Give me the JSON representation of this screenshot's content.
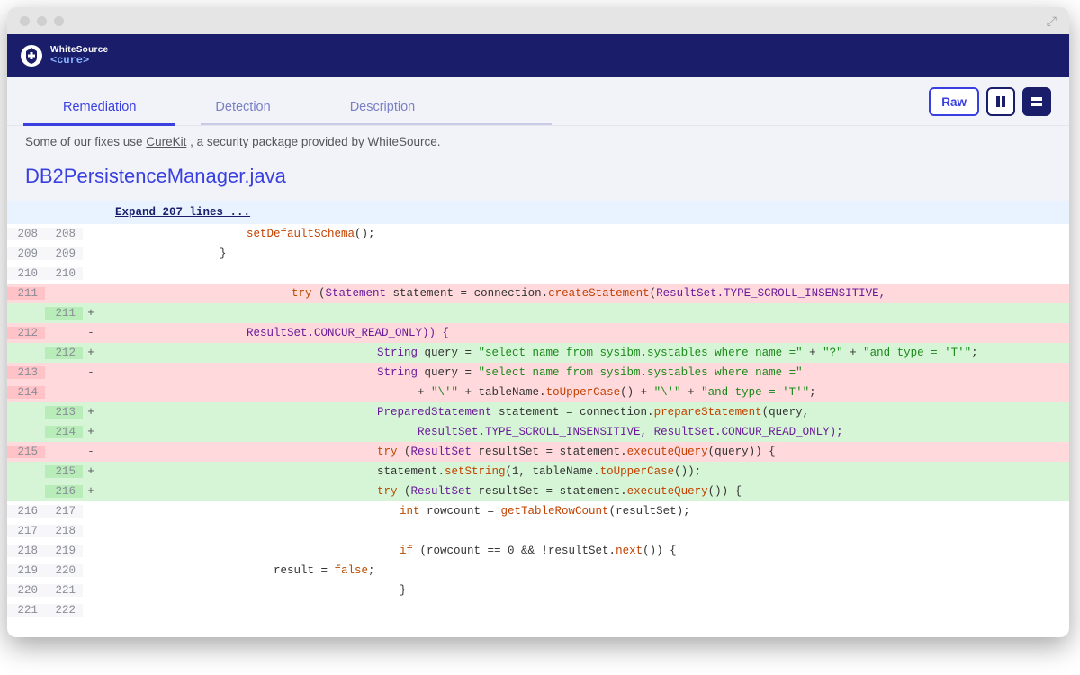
{
  "brand": {
    "name": "WhiteSource",
    "product": "<cure>"
  },
  "tabs": {
    "remediation": "Remediation",
    "detection": "Detection",
    "description": "Description"
  },
  "toolbar": {
    "raw": "Raw"
  },
  "note": {
    "pre": "Some of our fixes use ",
    "link": "CureKit",
    "post": " , a security package provided by WhiteSource."
  },
  "file": {
    "name": "DB2PersistenceManager.java"
  },
  "expand": {
    "label": "Expand 207 lines ..."
  },
  "lines": [
    {
      "type": "ctx",
      "old": "208",
      "new": "208",
      "sign": " ",
      "tokens": [
        {
          "ind": "w160"
        },
        {
          "t": "setDefaultSchema",
          "c": "mth"
        },
        {
          "t": "();",
          "c": "pun"
        }
      ]
    },
    {
      "type": "ctx",
      "old": "209",
      "new": "209",
      "sign": " ",
      "tokens": [
        {
          "ind": "w130"
        },
        {
          "t": "}",
          "c": "pun"
        }
      ]
    },
    {
      "type": "ctx",
      "old": "210",
      "new": "210",
      "sign": " ",
      "tokens": []
    },
    {
      "type": "del",
      "old": "211",
      "new": "",
      "sign": "-",
      "tokens": [
        {
          "ind": "w210"
        },
        {
          "t": "try",
          "c": "kw"
        },
        {
          "t": " ("
        },
        {
          "t": "Statement",
          "c": "typ"
        },
        {
          "t": " statement = connection."
        },
        {
          "t": "createStatement",
          "c": "mth"
        },
        {
          "t": "("
        },
        {
          "t": "ResultSet",
          "c": "typ"
        },
        {
          "t": ".TYPE_SCROLL_INSENSITIVE,",
          "c": "cnst"
        }
      ]
    },
    {
      "type": "add",
      "old": "",
      "new": "211",
      "sign": "+",
      "tokens": []
    },
    {
      "type": "del",
      "old": "212",
      "new": "",
      "sign": "-",
      "tokens": [
        {
          "ind": "w160"
        },
        {
          "t": "ResultSet",
          "c": "typ"
        },
        {
          "t": ".CONCUR_READ_ONLY)) {",
          "c": "cnst"
        }
      ]
    },
    {
      "type": "add",
      "old": "",
      "new": "212",
      "sign": "+",
      "tokens": [
        {
          "ind": "w305"
        },
        {
          "t": "String",
          "c": "typ"
        },
        {
          "t": " query = "
        },
        {
          "t": "\"select name from sysibm.systables where name =\"",
          "c": "str"
        },
        {
          "t": " + "
        },
        {
          "t": "\"?\"",
          "c": "str"
        },
        {
          "t": " + "
        },
        {
          "t": "\"and type = 'T'\"",
          "c": "str"
        },
        {
          "t": ";"
        }
      ]
    },
    {
      "type": "del",
      "old": "213",
      "new": "",
      "sign": "-",
      "tokens": [
        {
          "ind": "w305"
        },
        {
          "t": "String",
          "c": "typ"
        },
        {
          "t": " query = "
        },
        {
          "t": "\"select name from sysibm.systables where name =\"",
          "c": "str"
        }
      ]
    },
    {
      "type": "del",
      "old": "214",
      "new": "",
      "sign": "-",
      "tokens": [
        {
          "ind": "w350"
        },
        {
          "t": "+ "
        },
        {
          "t": "\"\\'\"",
          "c": "str"
        },
        {
          "t": " + tableName."
        },
        {
          "t": "toUpperCase",
          "c": "mth"
        },
        {
          "t": "() + "
        },
        {
          "t": "\"\\'\"",
          "c": "str"
        },
        {
          "t": " + "
        },
        {
          "t": "\"and type = 'T'\"",
          "c": "str"
        },
        {
          "t": ";"
        }
      ]
    },
    {
      "type": "add",
      "old": "",
      "new": "213",
      "sign": "+",
      "tokens": [
        {
          "ind": "w305"
        },
        {
          "t": "PreparedStatement",
          "c": "typ"
        },
        {
          "t": " statement = connection."
        },
        {
          "t": "prepareStatement",
          "c": "mth"
        },
        {
          "t": "(query,"
        }
      ]
    },
    {
      "type": "add",
      "old": "",
      "new": "214",
      "sign": "+",
      "tokens": [
        {
          "ind": "w350"
        },
        {
          "t": "ResultSet",
          "c": "typ"
        },
        {
          "t": ".TYPE_SCROLL_INSENSITIVE, ",
          "c": "cnst"
        },
        {
          "t": "ResultSet",
          "c": "typ"
        },
        {
          "t": ".CONCUR_READ_ONLY);",
          "c": "cnst"
        }
      ]
    },
    {
      "type": "del",
      "old": "215",
      "new": "",
      "sign": "-",
      "tokens": [
        {
          "ind": "w305"
        },
        {
          "t": "try",
          "c": "kw"
        },
        {
          "t": " ("
        },
        {
          "t": "ResultSet",
          "c": "typ"
        },
        {
          "t": " resultSet = statement."
        },
        {
          "t": "executeQuery",
          "c": "mth"
        },
        {
          "t": "(query)) {"
        }
      ]
    },
    {
      "type": "add",
      "old": "",
      "new": "215",
      "sign": "+",
      "tokens": [
        {
          "ind": "w305"
        },
        {
          "t": "statement."
        },
        {
          "t": "setString",
          "c": "mth"
        },
        {
          "t": "(1, tableName."
        },
        {
          "t": "toUpperCase",
          "c": "mth"
        },
        {
          "t": "());"
        }
      ]
    },
    {
      "type": "add",
      "old": "",
      "new": "216",
      "sign": "+",
      "tokens": [
        {
          "ind": "w305"
        },
        {
          "t": "try",
          "c": "kw"
        },
        {
          "t": " ("
        },
        {
          "t": "ResultSet",
          "c": "typ"
        },
        {
          "t": " resultSet = statement."
        },
        {
          "t": "executeQuery",
          "c": "mth"
        },
        {
          "t": "()) {"
        }
      ]
    },
    {
      "type": "ctx",
      "old": "216",
      "new": "217",
      "sign": " ",
      "tokens": [
        {
          "ind": "w330"
        },
        {
          "t": "int",
          "c": "kw"
        },
        {
          "t": " rowcount = "
        },
        {
          "t": "getTableRowCount",
          "c": "mth"
        },
        {
          "t": "(resultSet);"
        }
      ]
    },
    {
      "type": "ctx",
      "old": "217",
      "new": "218",
      "sign": " ",
      "tokens": []
    },
    {
      "type": "ctx",
      "old": "218",
      "new": "219",
      "sign": " ",
      "tokens": [
        {
          "ind": "w330"
        },
        {
          "t": "if",
          "c": "kw"
        },
        {
          "t": " (rowcount == 0 && !resultSet."
        },
        {
          "t": "next",
          "c": "mth"
        },
        {
          "t": "()) {"
        }
      ]
    },
    {
      "type": "ctx",
      "old": "219",
      "new": "220",
      "sign": " ",
      "tokens": [
        {
          "ind": "w190"
        },
        {
          "t": "result = "
        },
        {
          "t": "false",
          "c": "kw"
        },
        {
          "t": ";"
        }
      ]
    },
    {
      "type": "ctx",
      "old": "220",
      "new": "221",
      "sign": " ",
      "tokens": [
        {
          "ind": "w330"
        },
        {
          "t": "}",
          "c": "pun"
        }
      ]
    },
    {
      "type": "ctx",
      "old": "221",
      "new": "222",
      "sign": " ",
      "tokens": []
    }
  ]
}
